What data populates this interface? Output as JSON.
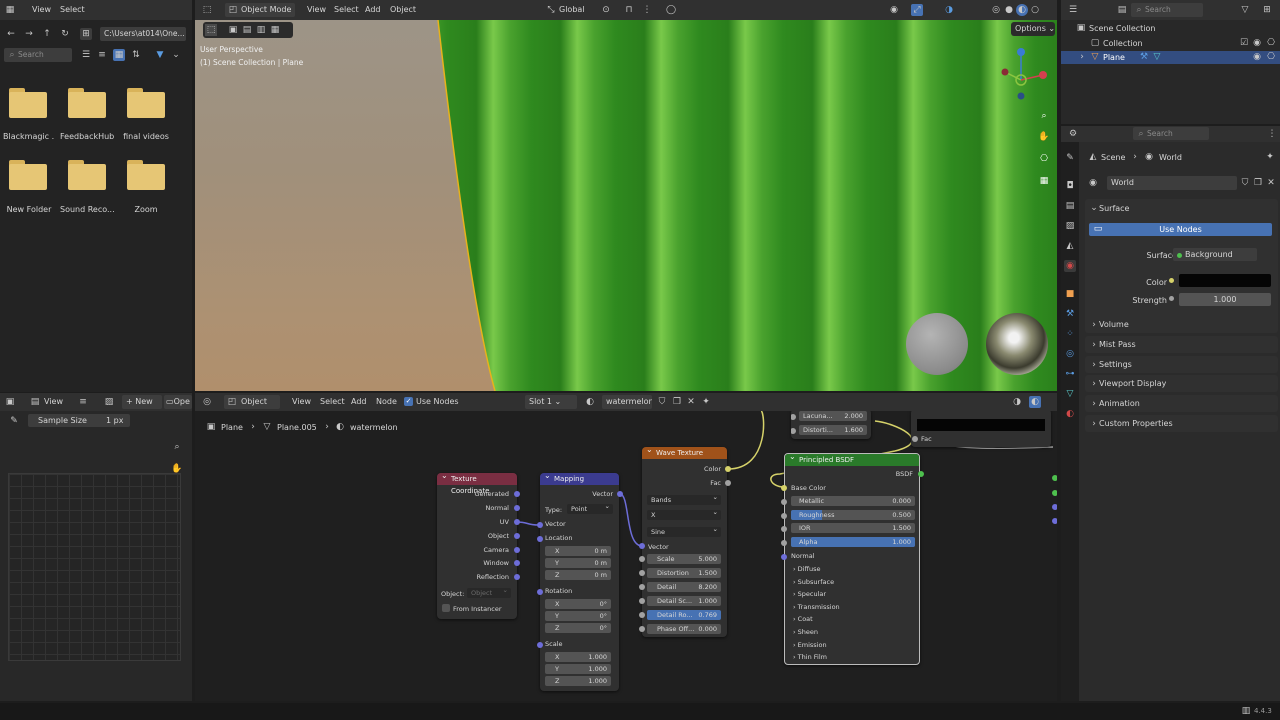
{
  "file_browser": {
    "menu": [
      "View",
      "Select"
    ],
    "path": "C:\\Users\\at014\\One...",
    "search_placeholder": "Search",
    "items": [
      "Blackmagic ...",
      "FeedbackHub",
      "final videos",
      "New Folder",
      "Sound Reco...",
      "Zoom"
    ]
  },
  "image_editor": {
    "menu_view": "View",
    "new_label": "New",
    "open_label": "Ope",
    "sample_label": "Sample Size",
    "sample_value": "1 px"
  },
  "viewport": {
    "mode": "Object Mode",
    "menu": [
      "View",
      "Select",
      "Add",
      "Object"
    ],
    "orientation": "Global",
    "options": "Options",
    "perspective": "User Perspective",
    "collection_line": "(1) Scene Collection | Plane"
  },
  "outliner": {
    "search_placeholder": "Search",
    "scene_collection": "Scene Collection",
    "collection": "Collection",
    "plane": "Plane"
  },
  "node_editor": {
    "type": "Object",
    "menu": [
      "View",
      "Select",
      "Add",
      "Node"
    ],
    "use_nodes": "Use Nodes",
    "slot": "Slot 1",
    "material": "watermelon",
    "breadcrumb": [
      "Plane",
      "Plane.005",
      "watermelon"
    ]
  },
  "nodes": {
    "texcoord": {
      "title": "Texture Coordinate",
      "outputs": [
        "Generated",
        "Normal",
        "UV",
        "Object",
        "Camera",
        "Window",
        "Reflection"
      ],
      "object_label": "Object:",
      "object_placeholder": "Object",
      "from_instancer": "From Instancer"
    },
    "mapping": {
      "title": "Mapping",
      "out": "Vector",
      "type_label": "Type:",
      "type_value": "Point",
      "vector": "Vector",
      "location": "Location",
      "rotation": "Rotation",
      "scale": "Scale",
      "loc": [
        [
          "X",
          "0 m"
        ],
        [
          "Y",
          "0 m"
        ],
        [
          "Z",
          "0 m"
        ]
      ],
      "rot": [
        [
          "X",
          "0°"
        ],
        [
          "Y",
          "0°"
        ],
        [
          "Z",
          "0°"
        ]
      ],
      "scl": [
        [
          "X",
          "1.000"
        ],
        [
          "Y",
          "1.000"
        ],
        [
          "Z",
          "1.000"
        ]
      ]
    },
    "wave": {
      "title": "Wave Texture",
      "color": "Color",
      "fac": "Fac",
      "type": "Bands",
      "dir": "X",
      "profile": "Sine",
      "vector": "Vector",
      "fields": [
        [
          "Scale",
          "5.000"
        ],
        [
          "Distortion",
          "1.500"
        ],
        [
          "Detail",
          "8.200"
        ],
        [
          "Detail Sc...",
          "1.000"
        ],
        [
          "Detail Ro...",
          "0.769"
        ],
        [
          "Phase Off...",
          "0.000"
        ]
      ]
    },
    "partial": {
      "lac_label": "Lacuna...",
      "lac_value": "2.000",
      "dist_label": "Distorti...",
      "dist_value": "1.600",
      "fac": "Fac"
    },
    "bsdf": {
      "title": "Principled BSDF",
      "out": "BSDF",
      "base_color": "Base Color",
      "fields": [
        [
          "Metallic",
          "0.000"
        ],
        [
          "Roughness",
          "0.500"
        ],
        [
          "IOR",
          "1.500"
        ],
        [
          "Alpha",
          "1.000"
        ]
      ],
      "roughness_fill": 0.5,
      "alpha_fill": 1.0,
      "normal": "Normal",
      "panels": [
        "Diffuse",
        "Subsurface",
        "Specular",
        "Transmission",
        "Coat",
        "Sheen",
        "Emission",
        "Thin Film"
      ]
    }
  },
  "properties": {
    "search_placeholder": "Search",
    "crumb_scene": "Scene",
    "crumb_world": "World",
    "world_name": "World",
    "surface": "Surface",
    "use_nodes": "Use Nodes",
    "surface_label": "Surface",
    "surface_value": "Background",
    "color_label": "Color",
    "strength_label": "Strength",
    "strength_value": "1.000",
    "panels": [
      "Volume",
      "Mist Pass",
      "Settings",
      "Viewport Display",
      "Animation",
      "Custom Properties"
    ]
  },
  "status": {
    "version": "4.4.3"
  },
  "colors": {
    "accent": "#4772b3",
    "texture_node": "#7a2e42",
    "vector_node": "#3b3b8f",
    "wave_node": "#a0521a",
    "shader_node": "#2a7a2a"
  }
}
